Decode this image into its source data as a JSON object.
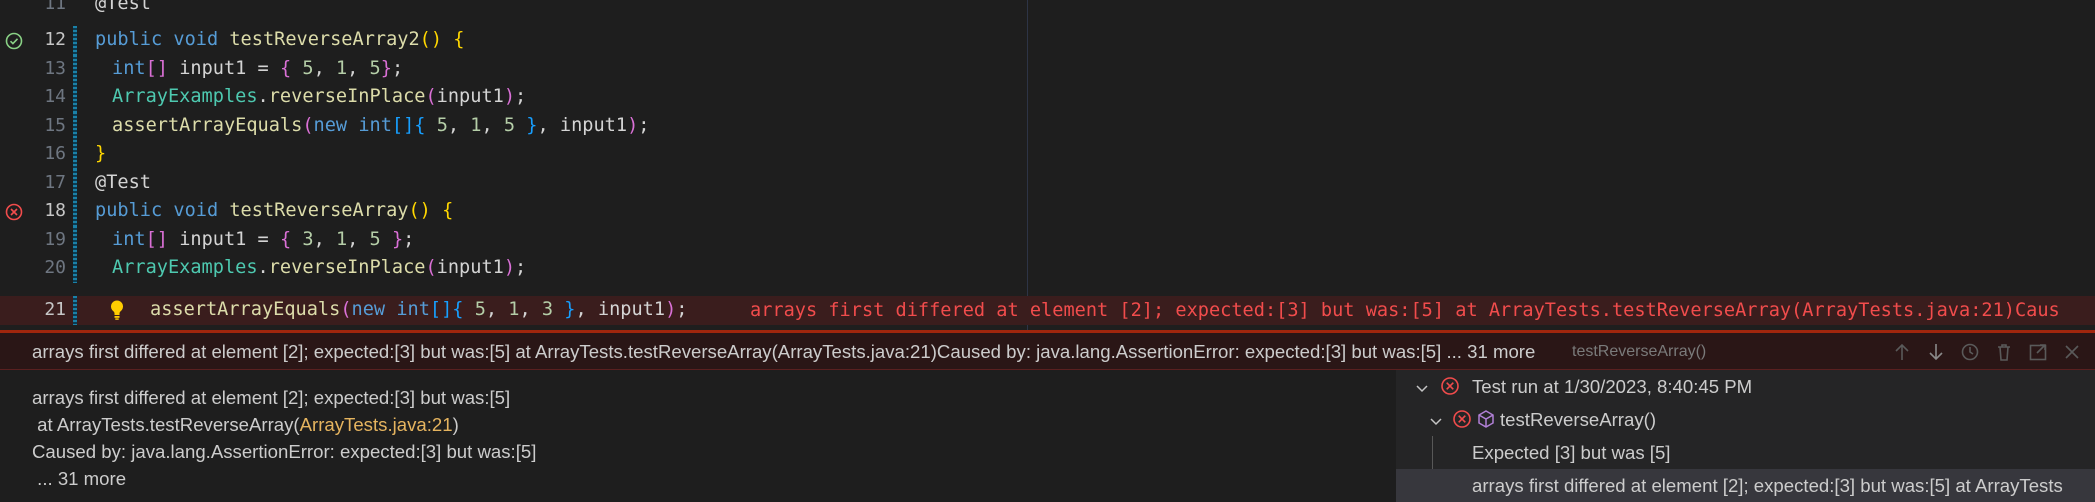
{
  "editor": {
    "lines": [
      {
        "no": "11",
        "annotation": "@Test"
      },
      {
        "no": "12",
        "kw1": "public",
        "kw2": "void",
        "fn": "testReverseArray2",
        "status": "pass"
      },
      {
        "no": "13",
        "type": "int",
        "var": "input1",
        "vals": [
          "5",
          "1",
          "5"
        ]
      },
      {
        "no": "14",
        "cls": "ArrayExamples",
        "method": "reverseInPlace",
        "arg": "input1"
      },
      {
        "no": "15",
        "fn": "assertArrayEquals",
        "kw": "new",
        "type": "int",
        "vals": [
          "5",
          "1",
          "5"
        ],
        "arg": "input1"
      },
      {
        "no": "16"
      },
      {
        "no": "17",
        "annotation": "@Test"
      },
      {
        "no": "18",
        "kw1": "public",
        "kw2": "void",
        "fn": "testReverseArray",
        "status": "fail"
      },
      {
        "no": "19",
        "type": "int",
        "var": "input1",
        "vals": [
          "3",
          "1",
          "5"
        ]
      },
      {
        "no": "20",
        "cls": "ArrayExamples",
        "method": "reverseInPlace",
        "arg": "input1"
      },
      {
        "no": "21",
        "fn": "assertArrayEquals",
        "kw": "new",
        "type": "int",
        "vals": [
          "5",
          "1",
          "3"
        ],
        "arg": "input1"
      }
    ],
    "inline_error": "arrays first differed at element [2]; expected:[3] but was:[5] at ArrayTests.testReverseArray(ArrayTests.java:21)Caus"
  },
  "panel": {
    "header_message": "arrays first differed at element [2]; expected:[3] but was:[5] at ArrayTests.testReverseArray(ArrayTests.java:21)Caused by: java.lang.AssertionError: expected:[3] but was:[5] ... 31 more",
    "header_test": "testReverseArray()",
    "output": {
      "line1": "arrays first differed at element [2]; expected:[3] but was:[5]",
      "line2_prefix": " at ArrayTests.testReverseArray(",
      "line2_link": "ArrayTests.java:21",
      "line2_suffix": ")",
      "line3": "Caused by: java.lang.AssertionError: expected:[3] but was:[5]",
      "line4": " ... 31 more"
    },
    "tree": {
      "run": "Test run at 1/30/2023, 8:40:45 PM",
      "test": "testReverseArray()",
      "msg1": "Expected [3] but was [5]",
      "msg2": "arrays first differed at element [2]; expected:[3] but was:[5] at ArrayTests"
    }
  },
  "colors": {
    "pass": "#89d185",
    "fail": "#f14c4c",
    "error_text": "#f14c4c",
    "link": "#e5b45f"
  },
  "icons": [
    "check-circle-icon",
    "error-circle-icon",
    "lightbulb-icon",
    "arrow-up-icon",
    "arrow-down-icon",
    "history-icon",
    "clear-icon",
    "open-external-icon",
    "close-icon",
    "chevron-down-icon",
    "method-cube-icon"
  ]
}
